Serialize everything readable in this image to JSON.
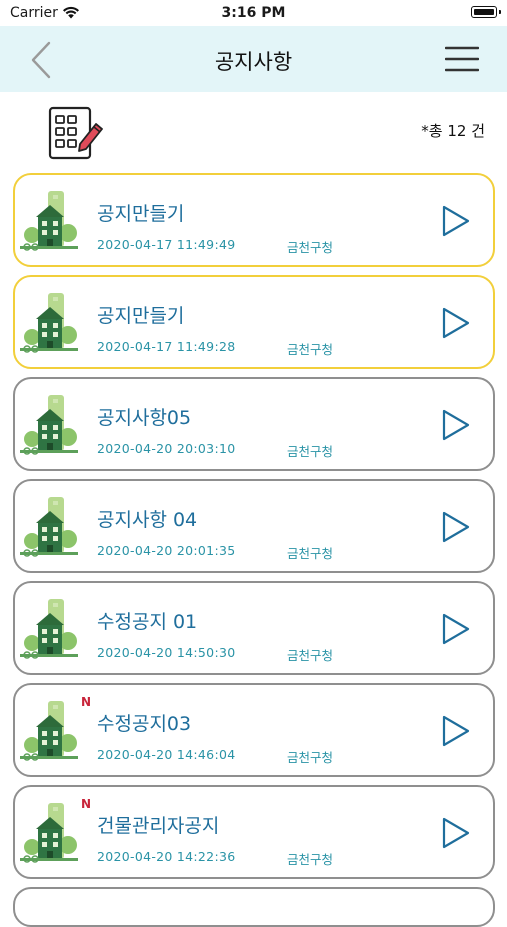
{
  "status_bar": {
    "carrier": "Carrier",
    "time": "3:16 PM"
  },
  "header": {
    "title": "공지사항",
    "back_icon": "chevron-left-icon",
    "menu_icon": "hamburger-menu-icon"
  },
  "summary": {
    "count_text": "*총 12 건",
    "icon": "document-edit-icon"
  },
  "colors": {
    "header_bg": "#e3f5f8",
    "highlight_border": "#f2cf3b",
    "normal_border": "#8f8f8f",
    "title_text": "#1f6e9c",
    "meta_text": "#2a93a6",
    "new_badge": "#c8243a",
    "arrow": "#1f6e9c"
  },
  "notices": [
    {
      "title": "공지만들기",
      "date": "2020-04-17 11:49:49",
      "org": "금천구청",
      "highlighted": true,
      "is_new": false
    },
    {
      "title": "공지만들기",
      "date": "2020-04-17 11:49:28",
      "org": "금천구청",
      "highlighted": true,
      "is_new": false
    },
    {
      "title": "공지사항05",
      "date": "2020-04-20 20:03:10",
      "org": "금천구청",
      "highlighted": false,
      "is_new": false
    },
    {
      "title": "공지사항 04",
      "date": "2020-04-20 20:01:35",
      "org": "금천구청",
      "highlighted": false,
      "is_new": false
    },
    {
      "title": "수정공지 01",
      "date": "2020-04-20 14:50:30",
      "org": "금천구청",
      "highlighted": false,
      "is_new": false
    },
    {
      "title": "수정공지03",
      "date": "2020-04-20 14:46:04",
      "org": "금천구청",
      "highlighted": false,
      "is_new": true,
      "badge": "N"
    },
    {
      "title": "건물관리자공지",
      "date": "2020-04-20 14:22:36",
      "org": "금천구청",
      "highlighted": false,
      "is_new": true,
      "badge": "N"
    }
  ]
}
